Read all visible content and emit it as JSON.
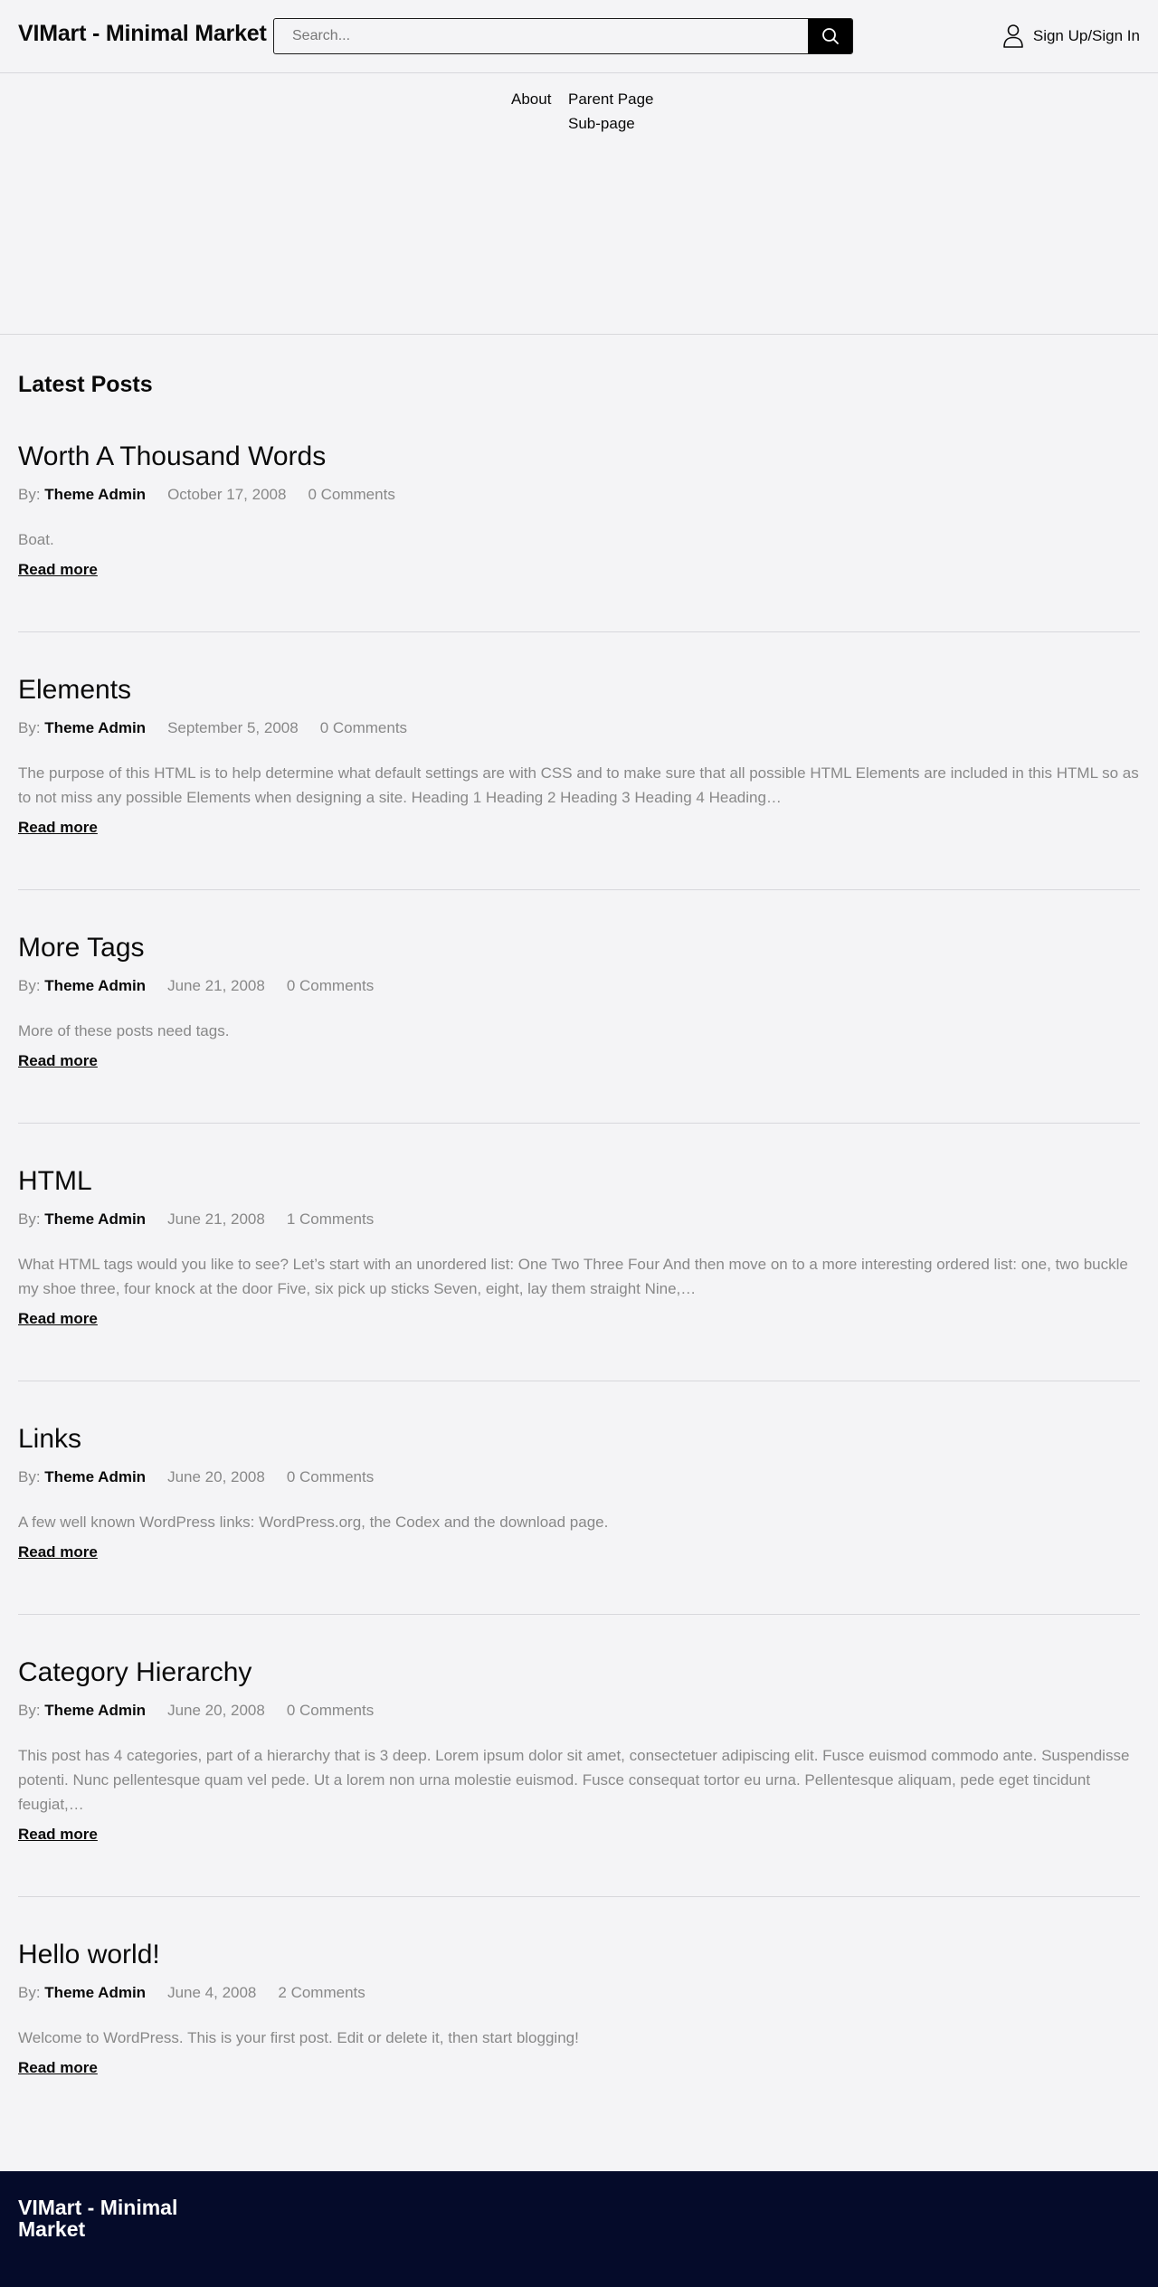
{
  "header": {
    "logo": "VIMart - Minimal Market",
    "search_placeholder": "Search...",
    "account_label": "Sign Up/Sign In"
  },
  "nav": {
    "about": "About",
    "parent": "Parent Page",
    "sub": "Sub-page"
  },
  "main": {
    "section_title": "Latest Posts",
    "by_label": "By:",
    "read_more": "Read more",
    "posts": [
      {
        "title": "Worth A Thousand Words",
        "author": "Theme Admin",
        "date": "October 17, 2008",
        "comments": "0 Comments",
        "excerpt": "Boat."
      },
      {
        "title": "Elements",
        "author": "Theme Admin",
        "date": "September 5, 2008",
        "comments": "0 Comments",
        "excerpt": "The purpose of this HTML is to help determine what default settings are with CSS and to make sure that all possible HTML Elements are included in this HTML so as to not miss any possible Elements when designing a site. Heading 1 Heading 2 Heading 3 Heading 4 Heading…"
      },
      {
        "title": "More Tags",
        "author": "Theme Admin",
        "date": "June 21, 2008",
        "comments": "0 Comments",
        "excerpt": "More of these posts need tags."
      },
      {
        "title": "HTML",
        "author": "Theme Admin",
        "date": "June 21, 2008",
        "comments": "1 Comments",
        "excerpt": "What HTML tags would you like to see? Let’s start with an unordered list: One Two Three Four And then move on to a more interesting ordered list: one, two buckle my shoe three, four knock at the door Five, six pick up sticks Seven, eight, lay them straight Nine,…"
      },
      {
        "title": "Links",
        "author": "Theme Admin",
        "date": "June 20, 2008",
        "comments": "0 Comments",
        "excerpt": "A few well known WordPress links: WordPress.org, the Codex and the download page."
      },
      {
        "title": "Category Hierarchy",
        "author": "Theme Admin",
        "date": "June 20, 2008",
        "comments": "0 Comments",
        "excerpt": "This post has 4 categories, part of a hierarchy that is 3 deep. Lorem ipsum dolor sit amet, consectetuer adipiscing elit. Fusce euismod commodo ante. Suspendisse potenti. Nunc pellentesque quam vel pede. Ut a lorem non urna molestie euismod. Fusce consequat tortor eu urna. Pellentesque aliquam, pede eget tincidunt feugiat,…"
      },
      {
        "title": "Hello world!",
        "author": "Theme Admin",
        "date": "June 4, 2008",
        "comments": "2 Comments",
        "excerpt": "Welcome to WordPress. This is your first post. Edit or delete it, then start blogging!"
      }
    ]
  },
  "footer": {
    "logo": "VIMart - Minimal Market"
  },
  "colors": {
    "background": "#f4f4f6",
    "footer_background": "#050b2a",
    "muted_text": "#888888"
  },
  "icons": {
    "search_button": "search-icon",
    "account": "user-icon"
  }
}
